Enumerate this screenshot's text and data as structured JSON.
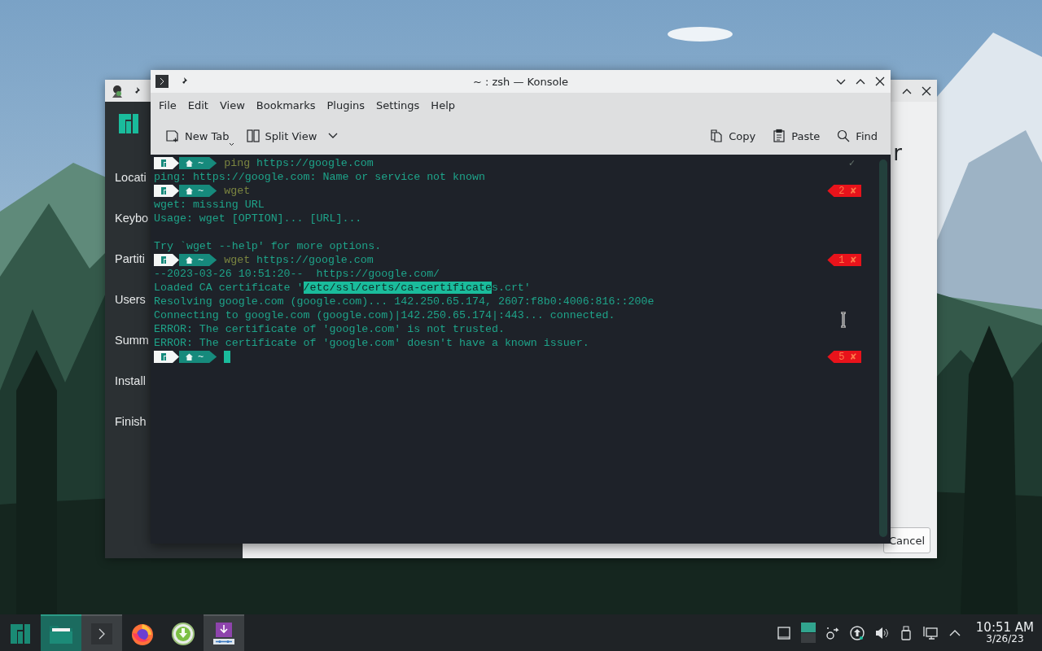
{
  "installer_window": {
    "sidebar_items": [
      {
        "label": "Locati"
      },
      {
        "label": "Keybo"
      },
      {
        "label": "Partiti"
      },
      {
        "label": "Users"
      },
      {
        "label": "Summ"
      },
      {
        "label": "Install"
      },
      {
        "label": "Finish"
      }
    ],
    "heading": "r",
    "cancel_button": "Cancel"
  },
  "konsole": {
    "title": "~ : zsh — Konsole",
    "menu": [
      "File",
      "Edit",
      "View",
      "Bookmarks",
      "Plugins",
      "Settings",
      "Help"
    ],
    "toolbar": [
      {
        "kind": "new-tab",
        "label": "New Tab"
      },
      {
        "kind": "split-view",
        "label": "Split View"
      },
      {
        "kind": "copy",
        "label": "Copy"
      },
      {
        "kind": "paste",
        "label": "Paste"
      },
      {
        "kind": "find",
        "label": "Find"
      }
    ],
    "lines": [
      {
        "kind": "prompt",
        "path": "~",
        "command": "ping",
        "args": "https://google.com",
        "cursor": false,
        "status": {
          "kind": "ok",
          "text": "✓"
        }
      },
      {
        "kind": "output",
        "segments": [
          {
            "text": "ping: https://google.com: Name or service not known",
            "selected": false
          }
        ]
      },
      {
        "kind": "prompt",
        "path": "~",
        "command": "wget",
        "cursor": false,
        "status": {
          "kind": "error",
          "text": "2 ✘"
        }
      },
      {
        "kind": "output",
        "segments": [
          {
            "text": "wget: missing URL",
            "selected": false
          }
        ]
      },
      {
        "kind": "output",
        "segments": [
          {
            "text": "Usage: wget [OPTION]... [URL]...",
            "selected": false
          }
        ]
      },
      {
        "kind": "blank"
      },
      {
        "kind": "output",
        "segments": [
          {
            "text": "Try `wget --help' for more options.",
            "selected": false
          }
        ]
      },
      {
        "kind": "prompt",
        "path": "~",
        "command": "wget",
        "args": "https://google.com",
        "cursor": false,
        "status": {
          "kind": "error",
          "text": "1 ✘"
        }
      },
      {
        "kind": "output",
        "segments": [
          {
            "text": "--2023-03-26 10:51:20--  https://google.com/",
            "selected": false
          }
        ]
      },
      {
        "kind": "output",
        "segments": [
          {
            "text": "Loaded CA certificate '",
            "selected": false
          },
          {
            "text": "/etc/ssl/certs/ca-certificate",
            "selected": true
          },
          {
            "text": "s.crt'",
            "selected": false
          }
        ]
      },
      {
        "kind": "output",
        "segments": [
          {
            "text": "Resolving google.com (google.com)... 142.250.65.174, 2607:f8b0:4006:816::200e",
            "selected": false
          }
        ]
      },
      {
        "kind": "output",
        "segments": [
          {
            "text": "Connecting to google.com (google.com)|142.250.65.174|:443... connected.",
            "selected": false
          }
        ]
      },
      {
        "kind": "output",
        "segments": [
          {
            "text": "ERROR: The certificate of 'google.com' is not trusted.",
            "selected": false
          }
        ]
      },
      {
        "kind": "output",
        "segments": [
          {
            "text": "ERROR: The certificate of 'google.com' doesn't have a known issuer.",
            "selected": false
          }
        ]
      },
      {
        "kind": "prompt",
        "path": "~",
        "cursor": true,
        "status": {
          "kind": "error",
          "text": "5 ✘"
        }
      }
    ]
  },
  "taskbar": {
    "apps": [
      {
        "kind": "menu",
        "open": false,
        "active": false
      },
      {
        "kind": "files",
        "open": true,
        "active": true
      },
      {
        "kind": "terminal",
        "open": true,
        "active": false
      },
      {
        "kind": "browser",
        "open": false,
        "active": false
      },
      {
        "kind": "updater",
        "open": false,
        "active": false
      },
      {
        "kind": "installer",
        "open": true,
        "active": false
      }
    ],
    "clock": {
      "time": "10:51 AM",
      "date": "3/26/23"
    }
  }
}
